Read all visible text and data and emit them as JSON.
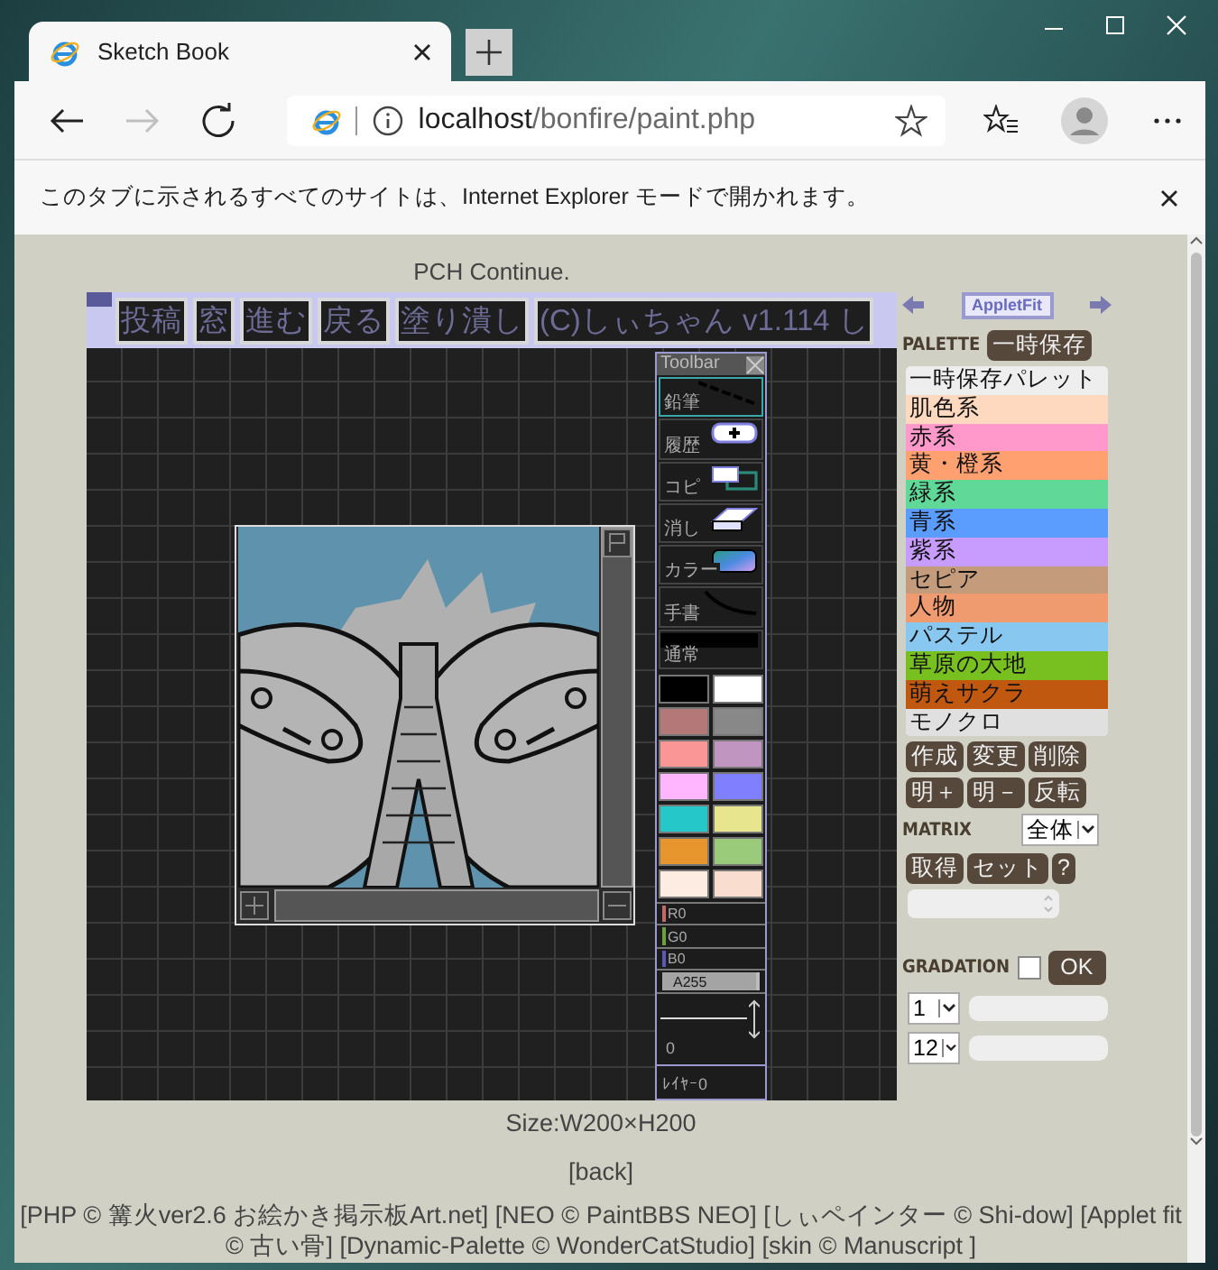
{
  "browser": {
    "tab_title": "Sketch Book",
    "url_host": "localhost",
    "url_path": "/bonfire/paint.php",
    "forward_disabled": true,
    "info_message": "このタブに示されるすべてのサイトは、Internet Explorer モードで開かれます。"
  },
  "page": {
    "status": "PCH Continue.",
    "size_text": "Size:W200×H200",
    "back_link": "[back]",
    "credits": "[PHP © 篝火ver2.6 お絵かき掲示板Art.net] [NEO © PaintBBS NEO] [しぃペインター © Shi-dow] [Applet fit © 古い骨] [Dynamic-Palette © WonderCatStudio] [skin © Manuscript ]"
  },
  "applet": {
    "buttons": [
      "投稿",
      "窓",
      "進む",
      "戻る",
      "塗り潰し",
      "(C)しぃちゃん v1.114 し"
    ],
    "toolbar": {
      "title": "Toolbar",
      "tools": [
        {
          "label": "鉛筆",
          "kind": "line",
          "selected": true
        },
        {
          "label": "履歴",
          "kind": "history",
          "selected": false
        },
        {
          "label": "コピ",
          "kind": "copy",
          "selected": false
        },
        {
          "label": "消し",
          "kind": "eraser",
          "selected": false
        },
        {
          "label": "カラー",
          "kind": "color",
          "selected": false
        },
        {
          "label": "手書",
          "kind": "curve",
          "selected": false
        },
        {
          "label": "通常",
          "kind": "bar",
          "selected": false
        }
      ],
      "swatches": [
        {
          "color": "#000000"
        },
        {
          "color": "#ffffff"
        },
        {
          "color": "#b47878"
        },
        {
          "color": "#888888"
        },
        {
          "color": "#fa9696"
        },
        {
          "color": "#c096c0"
        },
        {
          "color": "#ffb6ff"
        },
        {
          "color": "#8080ff"
        },
        {
          "color": "#25c7c9"
        },
        {
          "color": "#e7e58d"
        },
        {
          "color": "#e7962d"
        },
        {
          "color": "#99cb7b"
        },
        {
          "color": "#fcece2"
        },
        {
          "color": "#f9ddcf"
        }
      ],
      "sliders": [
        {
          "label": "R0",
          "level": 0,
          "color": "#c06a6a"
        },
        {
          "label": "G0",
          "level": 0,
          "color": "#6aa040"
        },
        {
          "label": "B0",
          "level": 0,
          "color": "#5a5ab0"
        },
        {
          "label": "A255",
          "level": 1,
          "color": "#bcbcbc"
        }
      ],
      "size": "0",
      "layer": "ﾚｲﾔｰ0"
    }
  },
  "side_panel": {
    "applet_fit": "AppletFit",
    "palette_label": "PALETTE",
    "save_button": "一時保存",
    "palettes": [
      {
        "label": "一時保存パレット",
        "color": "#eeeeee"
      },
      {
        "label": "肌色系",
        "color": "#ffd8c0"
      },
      {
        "label": "赤系",
        "color": "#ff99cc"
      },
      {
        "label": "黄・橙系",
        "color": "#ffa070"
      },
      {
        "label": "緑系",
        "color": "#60d898"
      },
      {
        "label": "青系",
        "color": "#5a9cff"
      },
      {
        "label": "紫系",
        "color": "#c89cff"
      },
      {
        "label": "セピア",
        "color": "#c49c7c"
      },
      {
        "label": "人物",
        "color": "#f09a70"
      },
      {
        "label": "パステル",
        "color": "#88c8f0"
      },
      {
        "label": "草原の大地",
        "color": "#78c020"
      },
      {
        "label": "萌えサクラ",
        "color": "#c05810"
      },
      {
        "label": "モノクロ",
        "color": "#e0e0e0"
      }
    ],
    "palette_buttons": [
      [
        "作成",
        "変更",
        "削除"
      ],
      [
        "明＋",
        "明－",
        "反転"
      ]
    ],
    "matrix_label": "MATRIX",
    "matrix_select": "全体",
    "matrix_buttons": [
      "取得",
      "セット",
      "?"
    ],
    "gradation": {
      "label": "GRADATION",
      "checked": false,
      "ok": "OK",
      "selects": [
        "1",
        "12"
      ]
    }
  }
}
